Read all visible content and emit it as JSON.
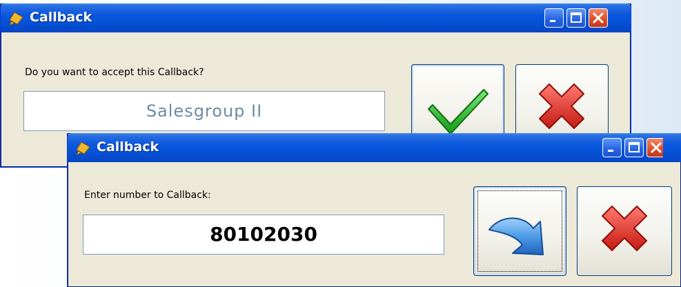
{
  "back_dialog": {
    "title": "Callback",
    "prompt": "Do you want to accept this Callback?",
    "value": "Salesgroup II"
  },
  "front_dialog": {
    "title": "Callback",
    "prompt": "Enter number to Callback:",
    "value": "80102030"
  },
  "icons": {
    "app": "phone-bell-icon",
    "accept": "green-checkmark-icon",
    "reject": "red-x-icon",
    "callback": "blue-arrow-icon",
    "minimize": "minimize-icon",
    "maximize": "maximize-icon",
    "close": "close-icon"
  },
  "colors": {
    "titlebar": "#0550d4",
    "client_bg": "#ece9d8",
    "accept_green": "#21b021",
    "reject_red": "#e2281e",
    "arrow_blue": "#3a86d8"
  }
}
